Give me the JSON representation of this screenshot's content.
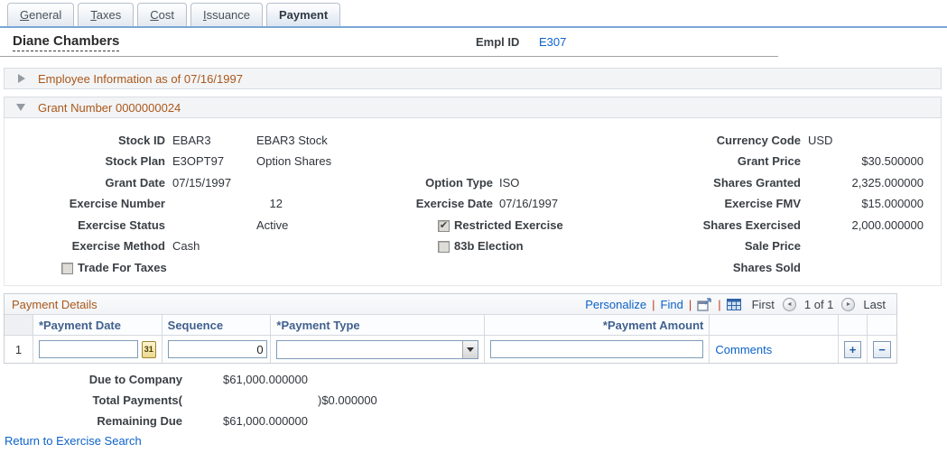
{
  "tabs": [
    {
      "u": "G",
      "rest": "eneral",
      "label": "General"
    },
    {
      "u": "T",
      "rest": "axes",
      "label": "Taxes"
    },
    {
      "u": "C",
      "rest": "ost",
      "label": "Cost"
    },
    {
      "u": "I",
      "rest": "ssuance",
      "label": "Issuance"
    },
    {
      "u": "",
      "rest": "Payment",
      "label": "Payment"
    }
  ],
  "header": {
    "employee_name": "Diane Chambers",
    "empl_id_label": "Empl ID",
    "empl_id_value": "E307"
  },
  "sections": {
    "employee_info_title": "Employee Information as of 07/16/1997",
    "grant_title": "Grant Number 0000000024"
  },
  "grant": {
    "stock_id_label": "Stock ID",
    "stock_id": "EBAR3",
    "stock_desc": "EBAR3 Stock",
    "stock_plan_label": "Stock Plan",
    "stock_plan": "E3OPT97",
    "stock_plan_desc": "Option Shares",
    "grant_date_label": "Grant Date",
    "grant_date": "07/15/1997",
    "exercise_number_label": "Exercise Number",
    "exercise_number": "12",
    "exercise_status_label": "Exercise Status",
    "exercise_status": "Active",
    "exercise_method_label": "Exercise Method",
    "exercise_method": "Cash",
    "trade_for_taxes_label": "Trade For Taxes",
    "trade_for_taxes_glyph": "",
    "option_type_label": "Option Type",
    "option_type": "ISO",
    "exercise_date_label": "Exercise Date",
    "exercise_date": "07/16/1997",
    "restricted_exercise_label": "Restricted Exercise",
    "restricted_exercise_glyph": "✔",
    "election_83b_label": "83b Election",
    "election_83b_glyph": "",
    "currency_code_label": "Currency Code",
    "currency_code": "USD",
    "grant_price_label": "Grant Price",
    "grant_price": "$30.500000",
    "shares_granted_label": "Shares Granted",
    "shares_granted": "2,325.000000",
    "exercise_fmv_label": "Exercise FMV",
    "exercise_fmv": "$15.000000",
    "shares_exercised_label": "Shares Exercised",
    "shares_exercised": "2,000.000000",
    "sale_price_label": "Sale Price",
    "sale_price": "",
    "shares_sold_label": "Shares Sold",
    "shares_sold": ""
  },
  "payment_grid": {
    "title": "Payment Details",
    "toolbar": {
      "personalize": "Personalize",
      "find": "Find",
      "sep": "|",
      "first": "First",
      "pagination": "1 of 1",
      "last": "Last",
      "prev_arrow": "◄",
      "next_arrow": "►"
    },
    "columns": {
      "date": "*Payment Date",
      "sequence": "Sequence",
      "type": "*Payment Type",
      "amount": "*Payment Amount"
    },
    "row": {
      "number": "1",
      "date_value": "",
      "sequence_value": "0",
      "type_value": "",
      "amount_value": "",
      "comments_label": "Comments",
      "calendar_icon_text": "31",
      "add_glyph": "+",
      "remove_glyph": "−"
    }
  },
  "summary": {
    "due_label": "Due to Company",
    "due_value": "$61,000.000000",
    "total_label": "Total Payments(",
    "total_value": ")$0.000000",
    "remaining_label": "Remaining Due",
    "remaining_value": "$61,000.000000"
  },
  "footer": {
    "return_link": "Return to Exercise Search"
  },
  "colors": {
    "section_title": "#a9581b",
    "link": "#0d62c9",
    "grid_header_text": "#41618e",
    "tab_underline": "#7aa7d6",
    "toolbar_separator": "#bf3a1f"
  }
}
